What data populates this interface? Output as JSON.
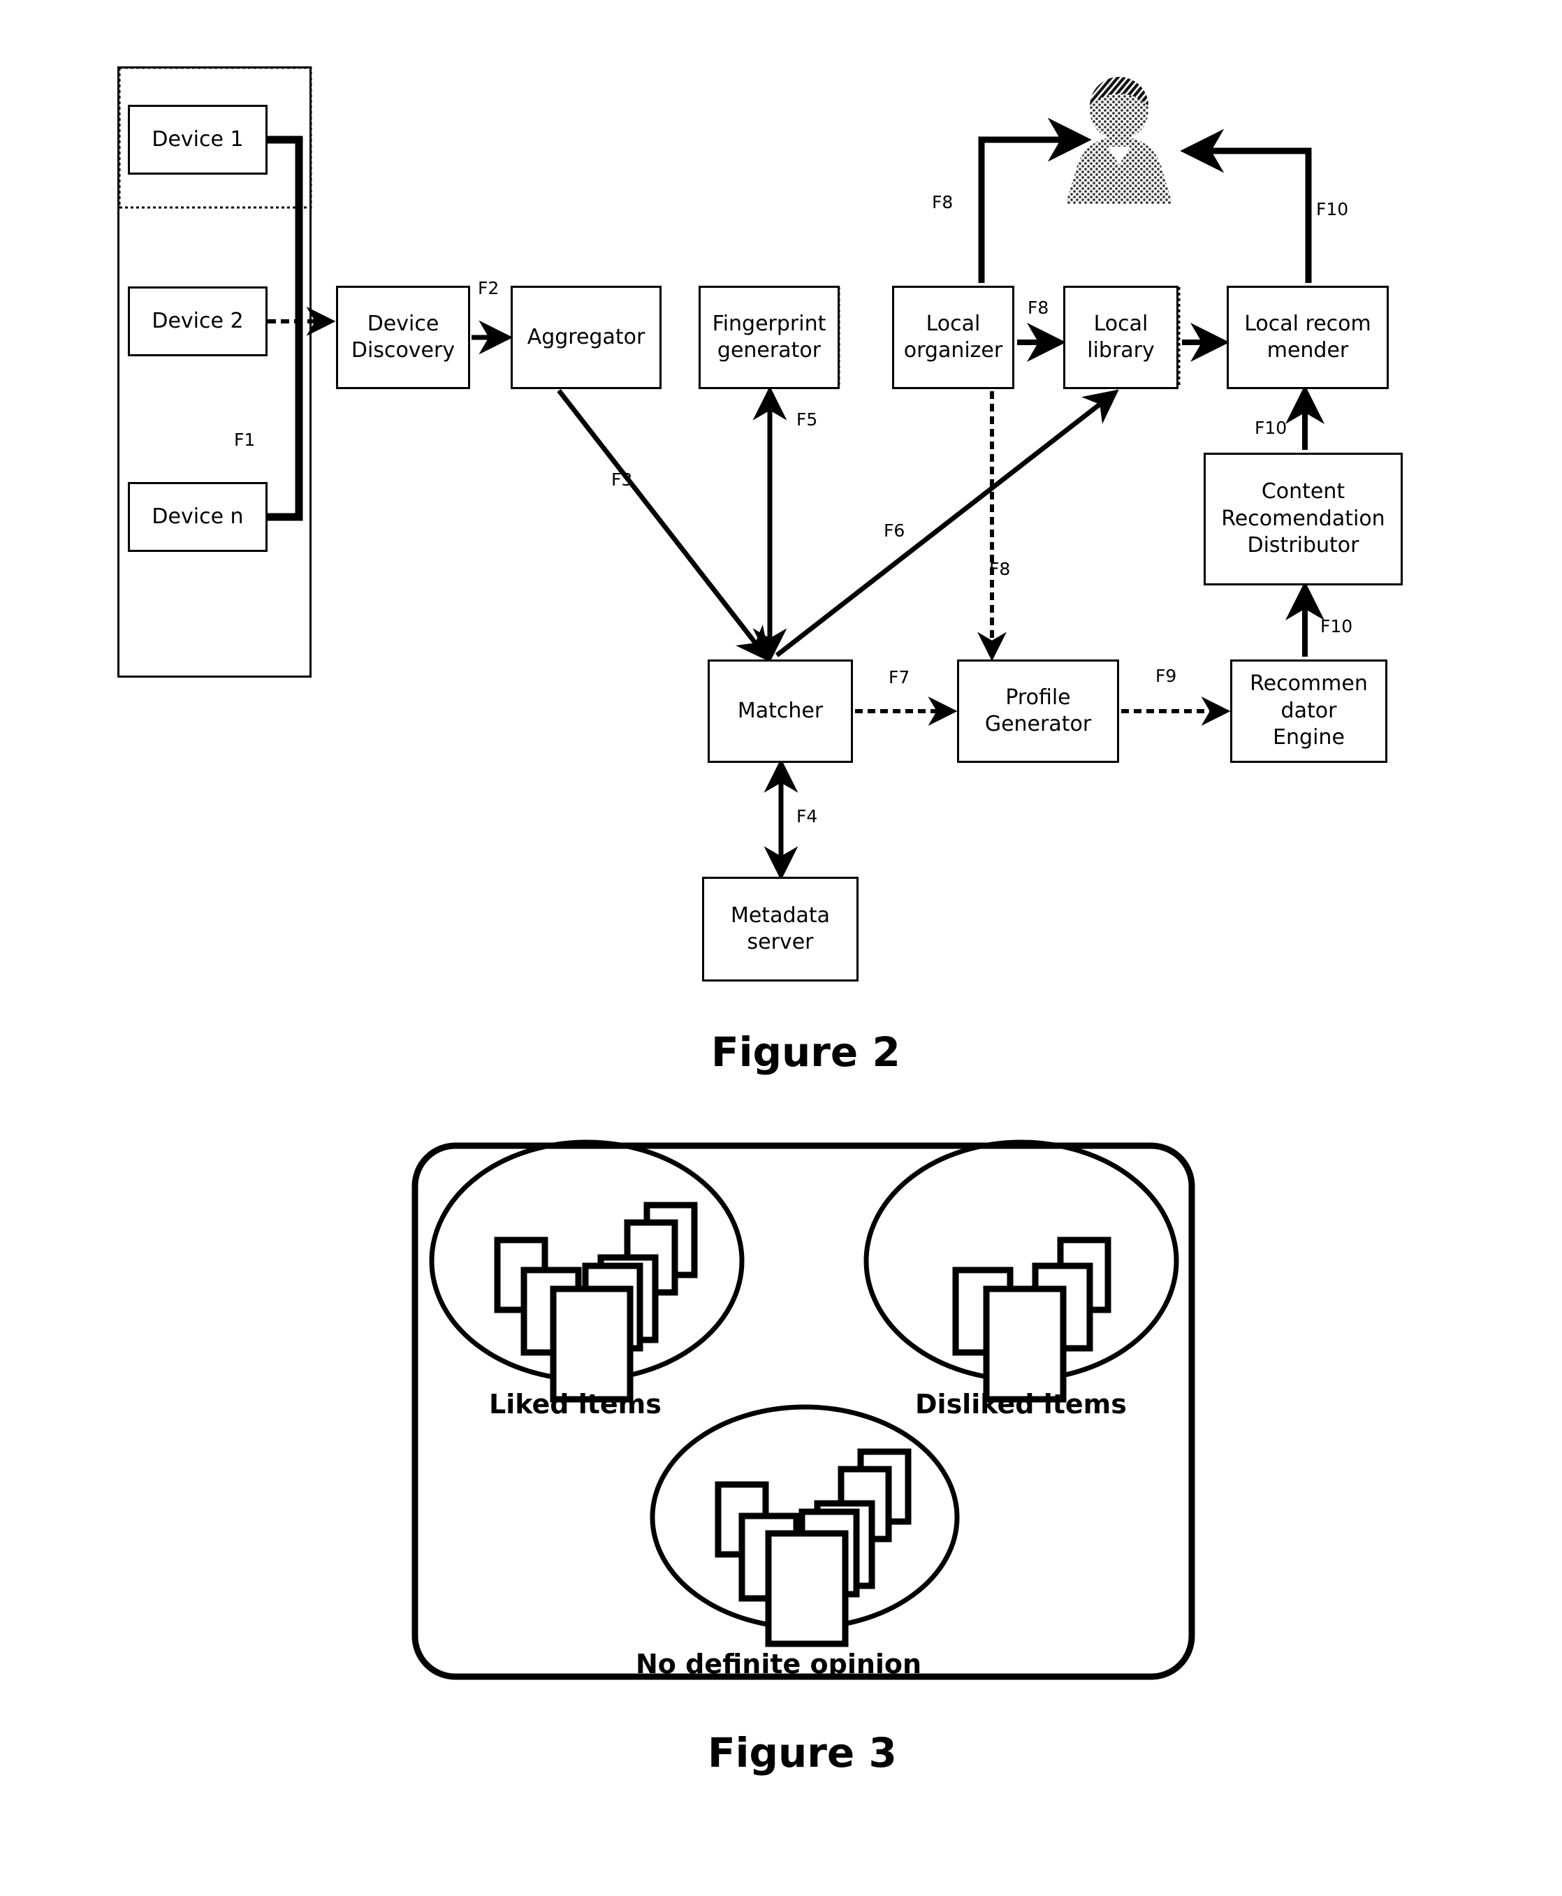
{
  "document": {
    "type": "patent-figure-sheet",
    "figures": [
      {
        "id": "figure-2",
        "caption": "Figure 2"
      },
      {
        "id": "figure-3",
        "caption": "Figure 3"
      }
    ]
  },
  "figure2": {
    "caption": "Figure 2",
    "device_group": {
      "devices": [
        {
          "id": "device-1",
          "label": "Device 1"
        },
        {
          "id": "device-2",
          "label": "Device 2"
        },
        {
          "id": "device-n",
          "label": "Device n"
        }
      ]
    },
    "blocks": [
      {
        "id": "device-discovery",
        "label": "Device\nDiscovery"
      },
      {
        "id": "aggregator",
        "label": "Aggregator"
      },
      {
        "id": "fingerprint-generator",
        "label": "Fingerprint\ngenerator"
      },
      {
        "id": "local-organizer",
        "label": "Local\norganizer"
      },
      {
        "id": "local-library",
        "label": "Local\nlibrary"
      },
      {
        "id": "local-recommender",
        "label": "Local recom\nmender"
      },
      {
        "id": "content-recommendation-distributor",
        "label": "Content\nRecomendation\nDistributor"
      },
      {
        "id": "matcher",
        "label": "Matcher"
      },
      {
        "id": "profile-generator",
        "label": "Profile\nGenerator"
      },
      {
        "id": "recommendator-engine",
        "label": "Recommen\ndator\nEngine"
      },
      {
        "id": "metadata-server",
        "label": "Metadata\nserver"
      }
    ],
    "block_labels": {
      "device_discovery": "Device Discovery",
      "device_discovery_line1": "Device",
      "device_discovery_line2": "Discovery",
      "aggregator": "Aggregator",
      "fingerprint_line1": "Fingerprint",
      "fingerprint_line2": "generator",
      "local_organizer_line1": "Local",
      "local_organizer_line2": "organizer",
      "local_library_line1": "Local",
      "local_library_line2": "library",
      "local_recommender_line1": "Local recom",
      "local_recommender_line2": "mender",
      "crd_line1": "Content",
      "crd_line2": "Recomendation",
      "crd_line3": "Distributor",
      "matcher": "Matcher",
      "profile_generator_line1": "Profile",
      "profile_generator_line2": "Generator",
      "recommendator_line1": "Recommen",
      "recommendator_line2": "dator",
      "recommendator_line3": "Engine",
      "metadata_server_line1": "Metadata",
      "metadata_server_line2": "server"
    },
    "flow_labels": [
      {
        "id": "f1",
        "text": "F1",
        "from": "devices",
        "to": "device-discovery"
      },
      {
        "id": "f2",
        "text": "F2",
        "from": "device-discovery",
        "to": "aggregator"
      },
      {
        "id": "f3",
        "text": "F3",
        "from": "aggregator",
        "to": "matcher"
      },
      {
        "id": "f4",
        "text": "F4",
        "from": "matcher",
        "to": "metadata-server"
      },
      {
        "id": "f5",
        "text": "F5",
        "from": "matcher",
        "to": "fingerprint-generator"
      },
      {
        "id": "f6",
        "text": "F6",
        "from": "matcher",
        "to": "local-library"
      },
      {
        "id": "f7",
        "text": "F7",
        "from": "matcher",
        "to": "profile-generator"
      },
      {
        "id": "f8a",
        "text": "F8",
        "from": "local-organizer",
        "to": "user"
      },
      {
        "id": "f8b",
        "text": "F8",
        "from": "local-organizer",
        "to": "local-library"
      },
      {
        "id": "f8c",
        "text": "F8",
        "from": "local-organizer",
        "to": "profile-generator"
      },
      {
        "id": "f9",
        "text": "F9",
        "from": "profile-generator",
        "to": "recommendator-engine"
      },
      {
        "id": "f10a",
        "text": "F10",
        "from": "local-recommender",
        "to": "user"
      },
      {
        "id": "f10b",
        "text": "F10",
        "from": "content-recommendation-distributor",
        "to": "local-recommender"
      },
      {
        "id": "f10c",
        "text": "F10",
        "from": "recommendator-engine",
        "to": "content-recommendation-distributor"
      }
    ],
    "actor": {
      "id": "user",
      "name": "user-silhouette"
    }
  },
  "figure3": {
    "caption": "Figure 3",
    "clusters": [
      {
        "id": "liked-items",
        "label": "Liked items",
        "card_count": 7
      },
      {
        "id": "disliked-items",
        "label": "Disliked items",
        "card_count": 4
      },
      {
        "id": "no-definite-opinion",
        "label": "No definite opinion",
        "card_count": 7
      }
    ]
  },
  "colors": {
    "ink": "#000000",
    "paper": "#ffffff"
  }
}
